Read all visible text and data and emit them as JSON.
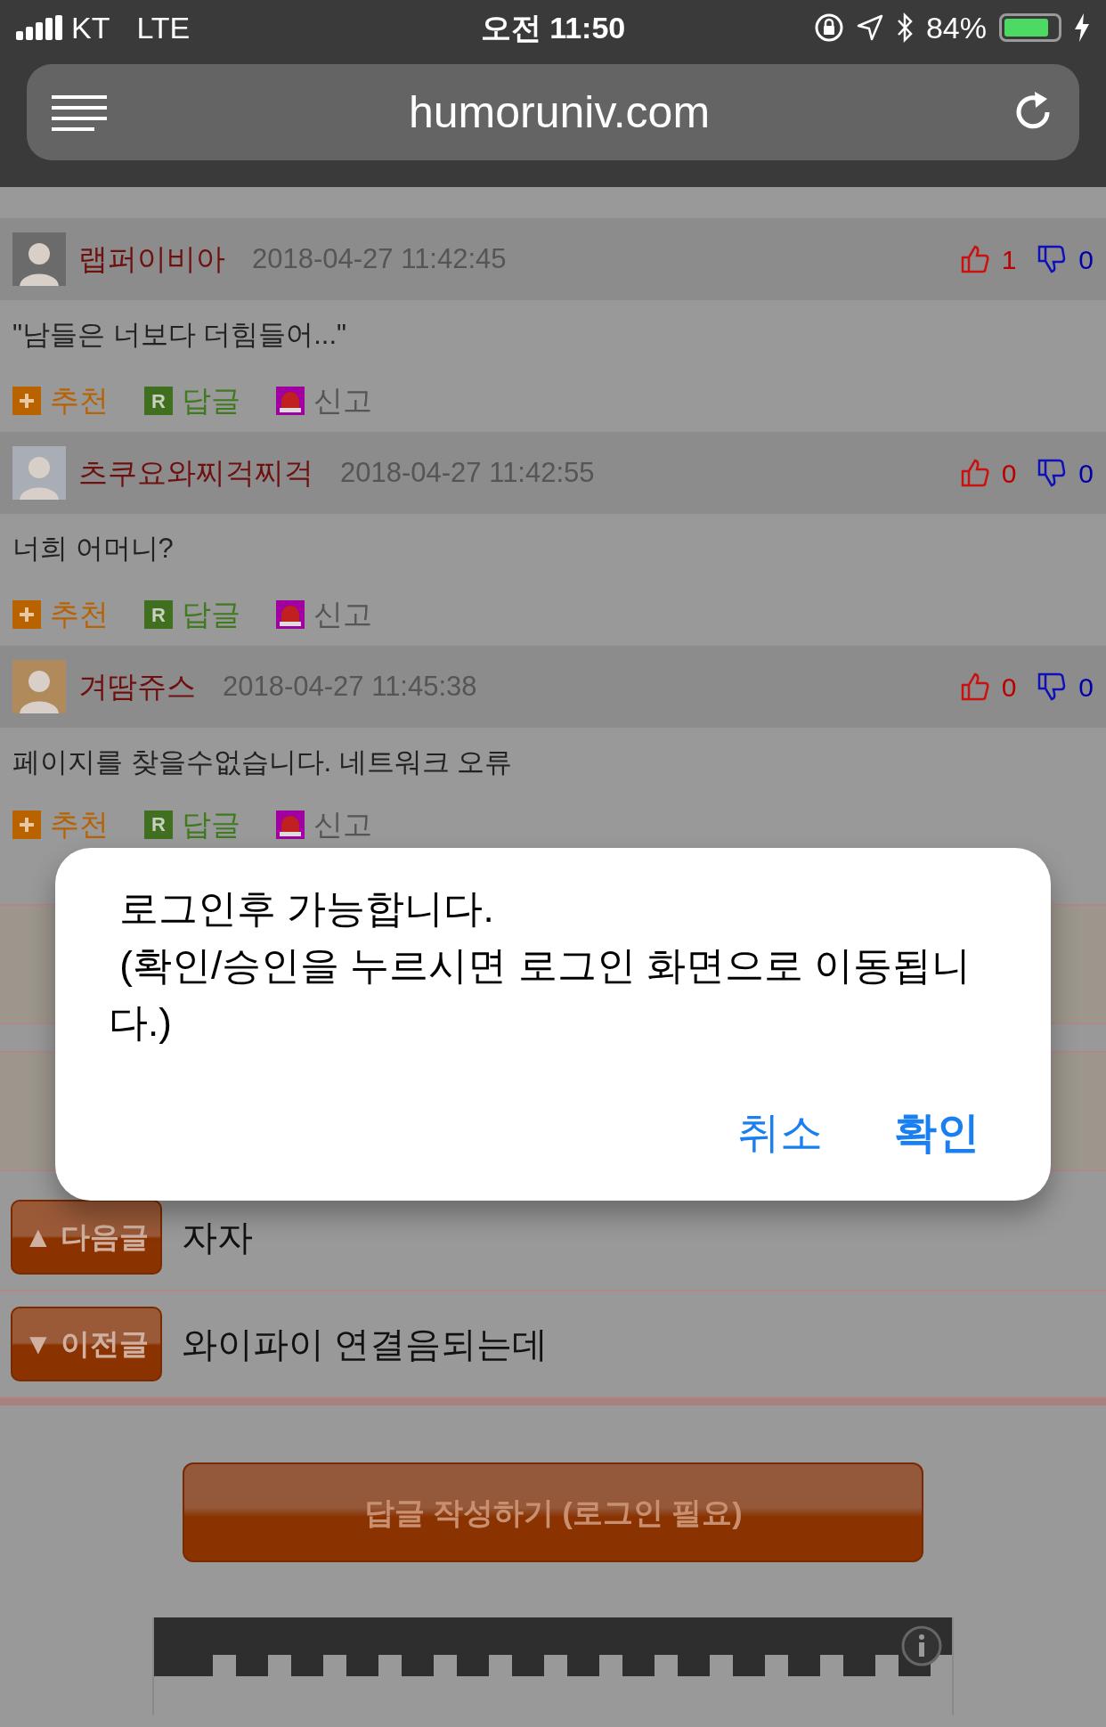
{
  "status_bar": {
    "carrier": "KT",
    "network": "LTE",
    "time": "오전 11:50",
    "battery_percent": "84%"
  },
  "address_bar": {
    "url": "humoruniv.com"
  },
  "comments": [
    {
      "author": "랩퍼이비아",
      "date": "2018-04-27 11:42:45",
      "likes": "1",
      "dislikes": "0",
      "text": "\"남들은 너보다 더힘들어...\"",
      "actions": [
        {
          "kind": "recommend",
          "label": "추천"
        },
        {
          "kind": "reply",
          "label": "답글",
          "icon_text": "R"
        },
        {
          "kind": "report",
          "label": "신고"
        }
      ]
    },
    {
      "author": "츠쿠요와찌걱찌걱",
      "date": "2018-04-27 11:42:55",
      "likes": "0",
      "dislikes": "0",
      "text": "너희 어머니?",
      "actions": [
        {
          "kind": "recommend",
          "label": "추천"
        },
        {
          "kind": "reply",
          "label": "답글",
          "icon_text": "R"
        },
        {
          "kind": "report",
          "label": "신고"
        }
      ]
    },
    {
      "author": "겨땀쥬스",
      "date": "2018-04-27 11:45:38",
      "likes": "0",
      "dislikes": "0",
      "text": "페이지를 찾을수없습니다. 네트워크 오류",
      "actions": [
        {
          "kind": "recommend",
          "label": "추천"
        },
        {
          "kind": "reply",
          "label": "답글",
          "icon_text": "R"
        },
        {
          "kind": "report",
          "label": "신고"
        }
      ]
    }
  ],
  "post_nav": [
    {
      "button": "▲ 다음글",
      "title": "자자"
    },
    {
      "button": "▼ 이전글",
      "title": "와이파이 연결음되는데"
    }
  ],
  "reply_button": "답글 작성하기 (로그인 필요)",
  "dialog": {
    "message_lines": [
      " 로그인후 가능합니다.",
      " (확인/승인을 누르시면 로그인 화면으로 이동됩니다.)"
    ],
    "buttons": [
      {
        "label": "취소",
        "primary": false
      },
      {
        "label": "확인",
        "primary": true
      }
    ]
  }
}
